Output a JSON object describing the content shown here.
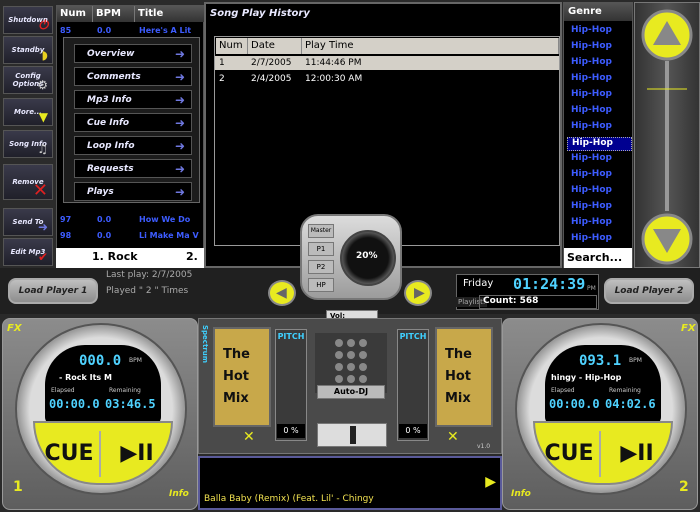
{
  "sidebar": {
    "buttons": [
      {
        "label": "Shutdown",
        "icon": "shutdown-icon"
      },
      {
        "label": "Standby",
        "icon": "standby-icon"
      },
      {
        "label": "Config Options",
        "icon": "config-icon"
      },
      {
        "label": "More...",
        "icon": "more-icon"
      },
      {
        "label": "Song Info",
        "icon": "song-info-icon"
      },
      {
        "label": "Remove",
        "icon": "remove-icon"
      },
      {
        "label": "Send To",
        "icon": "send-to-icon"
      },
      {
        "label": "Edit Mp3",
        "icon": "edit-icon"
      }
    ]
  },
  "tracklist": {
    "headers": [
      "Num",
      "BPM",
      "Title"
    ],
    "rows": [
      {
        "num": "85",
        "bpm": "0.0",
        "title": "Here's A Lit"
      },
      {
        "num": "97",
        "bpm": "0.0",
        "title": "How We Do"
      },
      {
        "num": "98",
        "bpm": "0.0",
        "title": "Li Make Ma V"
      }
    ],
    "footer_left": "1. Rock",
    "footer_right": "2."
  },
  "info_panel": {
    "buttons": [
      "Overview",
      "Comments",
      "Mp3 Info",
      "Cue Info",
      "Loop Info",
      "Requests",
      "Plays"
    ]
  },
  "history": {
    "title": "Song Play History",
    "headers": [
      "Num",
      "Date",
      "Play Time"
    ],
    "rows": [
      {
        "num": "1",
        "date": "2/7/2005",
        "time": "11:44:46 PM"
      },
      {
        "num": "2",
        "date": "2/4/2005",
        "time": "12:00:30 AM"
      }
    ]
  },
  "genre": {
    "header": "Genre",
    "items": [
      "Hip-Hop",
      "Hip-Hop",
      "Hip-Hop",
      "Hip-Hop",
      "Hip-Hop",
      "Hip-Hop",
      "Hip-Hop",
      "Hip-Hop",
      "Hip-Hop",
      "Hip-Hop",
      "Hip-Hop",
      "Hip-Hop",
      "Hip-Hop",
      "Hip-Hop"
    ],
    "selected_index": 7,
    "search_placeholder": "Search..."
  },
  "mid": {
    "load1": "Load Player 1",
    "load2": "Load Player 2",
    "last_play": "Last play: 2/7/2005",
    "played": "Played \" 2 \" Times",
    "day": "Friday",
    "clock": "01:24:39",
    "ampm": "PM",
    "playlist_label": "Playlist:",
    "count": "Count: 568"
  },
  "knob": {
    "master": "Master",
    "p1": "P1",
    "p2": "P2",
    "hp": "HP",
    "value": "20%",
    "vol": "Vol:"
  },
  "deck1": {
    "bpm": "000.0",
    "bpm_unit": "BPM",
    "track": "- Rock Its M",
    "elapsed_label": "Elapsed",
    "remaining_label": "Remaining",
    "elapsed": "00:00.0",
    "remaining": "03:46.5",
    "cue": "CUE",
    "play": "▶II",
    "num": "1",
    "info": "Info",
    "fx": "FX",
    "pitch_label": "PITCH",
    "pitch": "0 %"
  },
  "deck2": {
    "bpm": "093.1",
    "bpm_unit": "BPM",
    "track": "hingy - Hip-Hop",
    "elapsed_label": "Elapsed",
    "remaining_label": "Remaining",
    "elapsed": "00:00.0",
    "remaining": "04:02.6",
    "cue": "CUE",
    "play": "▶II",
    "num": "2",
    "info": "Info",
    "fx": "FX",
    "pitch_label": "PITCH",
    "pitch": "0 %"
  },
  "mixer": {
    "hotmix_line1": "The",
    "hotmix_line2": "Hot",
    "hotmix_line3": "Mix",
    "auto_dj": "Auto-DJ",
    "version": "v1.0",
    "spectrum": "Spectrum"
  },
  "songbar": {
    "text": "Balla Baby (Remix) (Feat. Lil' - Chingy"
  },
  "colors": {
    "accent_blue": "#3d5cff",
    "lcd_blue": "#4fd2ff",
    "yellow": "#e8ea20"
  }
}
